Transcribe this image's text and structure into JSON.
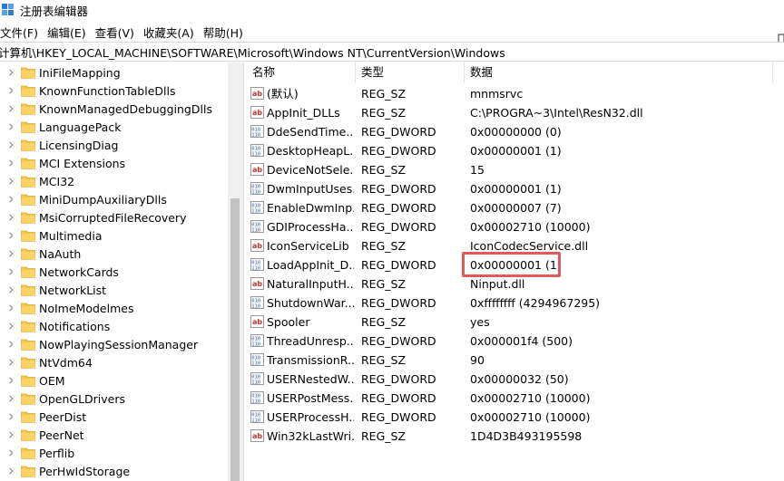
{
  "window": {
    "title": "注册表编辑器"
  },
  "menu": [
    "文件(F)",
    "编辑(E)",
    "查看(V)",
    "收藏夹(A)",
    "帮助(H)"
  ],
  "address": "计算机\\HKEY_LOCAL_MACHINE\\SOFTWARE\\Microsoft\\Windows NT\\CurrentVersion\\Windows",
  "tree": [
    "IniFileMapping",
    "KnownFunctionTableDlls",
    "KnownManagedDebuggingDlls",
    "LanguagePack",
    "LicensingDiag",
    "MCI Extensions",
    "MCI32",
    "MiniDumpAuxiliaryDlls",
    "MsiCorruptedFileRecovery",
    "Multimedia",
    "NaAuth",
    "NetworkCards",
    "NetworkList",
    "NoImeModelmes",
    "Notifications",
    "NowPlayingSessionManager",
    "NtVdm64",
    "OEM",
    "OpenGLDrivers",
    "PeerDist",
    "PeerNet",
    "Perflib",
    "PerHwIdStorage"
  ],
  "columns": {
    "name": "名称",
    "type": "类型",
    "data": "数据"
  },
  "values": [
    {
      "icon": "string-value-icon",
      "name": "(默认)",
      "type": "REG_SZ",
      "data": "mnmsrvc"
    },
    {
      "icon": "string-value-icon",
      "name": "AppInit_DLLs",
      "type": "REG_SZ",
      "data": "C:\\PROGRA~3\\Intel\\ResN32.dll"
    },
    {
      "icon": "binary-value-icon",
      "name": "DdeSendTime...",
      "type": "REG_DWORD",
      "data": "0x00000000 (0)"
    },
    {
      "icon": "binary-value-icon",
      "name": "DesktopHeapL...",
      "type": "REG_DWORD",
      "data": "0x00000001 (1)"
    },
    {
      "icon": "string-value-icon",
      "name": "DeviceNotSele...",
      "type": "REG_SZ",
      "data": "15"
    },
    {
      "icon": "binary-value-icon",
      "name": "DwmInputUses...",
      "type": "REG_DWORD",
      "data": "0x00000001 (1)"
    },
    {
      "icon": "binary-value-icon",
      "name": "EnableDwmInp...",
      "type": "REG_DWORD",
      "data": "0x00000007 (7)"
    },
    {
      "icon": "binary-value-icon",
      "name": "GDIProcessHa...",
      "type": "REG_DWORD",
      "data": "0x00002710 (10000)"
    },
    {
      "icon": "string-value-icon",
      "name": "IconServiceLib",
      "type": "REG_SZ",
      "data": "IconCodecService.dll"
    },
    {
      "icon": "binary-value-icon",
      "name": "LoadAppInit_D...",
      "type": "REG_DWORD",
      "data": "0x00000001 (1)"
    },
    {
      "icon": "string-value-icon",
      "name": "NaturalInputH...",
      "type": "REG_SZ",
      "data": "Ninput.dll"
    },
    {
      "icon": "binary-value-icon",
      "name": "ShutdownWar...",
      "type": "REG_DWORD",
      "data": "0xffffffff (4294967295)"
    },
    {
      "icon": "string-value-icon",
      "name": "Spooler",
      "type": "REG_SZ",
      "data": "yes"
    },
    {
      "icon": "binary-value-icon",
      "name": "ThreadUnresp...",
      "type": "REG_DWORD",
      "data": "0x000001f4 (500)"
    },
    {
      "icon": "binary-value-icon",
      "name": "TransmissionR...",
      "type": "REG_SZ",
      "data": "90"
    },
    {
      "icon": "binary-value-icon",
      "name": "USERNestedW...",
      "type": "REG_DWORD",
      "data": "0x00000032 (50)"
    },
    {
      "icon": "binary-value-icon",
      "name": "USERPostMess...",
      "type": "REG_DWORD",
      "data": "0x00002710 (10000)"
    },
    {
      "icon": "binary-value-icon",
      "name": "USERProcessH...",
      "type": "REG_DWORD",
      "data": "0x00002710 (10000)"
    },
    {
      "icon": "string-value-icon",
      "name": "Win32kLastWri...",
      "type": "REG_SZ",
      "data": "1D4D3B493195598"
    }
  ],
  "highlighted_value": "LoadAppInit_D...",
  "colors": {
    "highlight_border": "#e05a5a",
    "folder": "#f4c84a",
    "accent": "#2b7bd6"
  }
}
